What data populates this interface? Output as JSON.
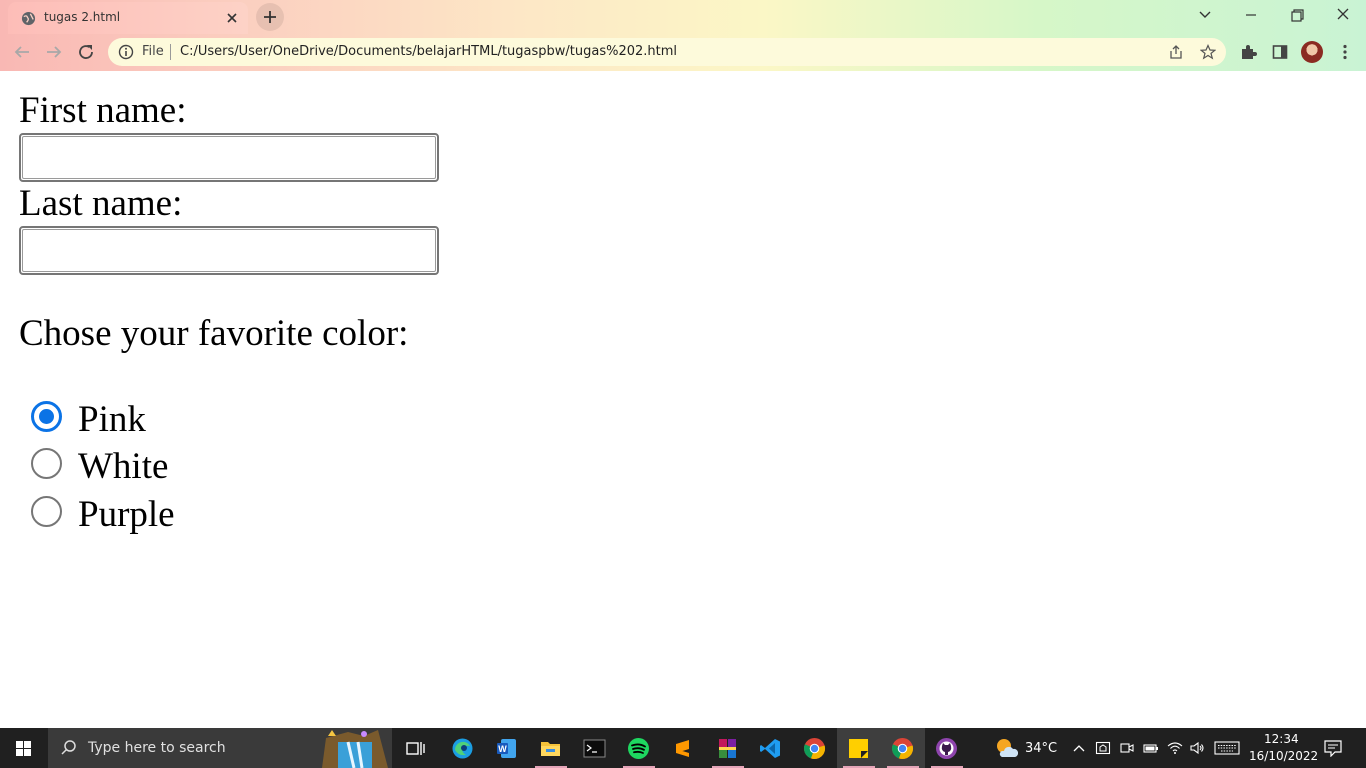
{
  "browser": {
    "tab_title": "tugas 2.html",
    "omnibox_scheme": "File",
    "url": "C:/Users/User/OneDrive/Documents/belajarHTML/tugaspbw/tugas%202.html"
  },
  "form": {
    "first_name_label": "First name:",
    "first_name_value": "",
    "last_name_label": "Last name:",
    "last_name_value": "",
    "color_prompt": "Chose your favorite color:",
    "options": [
      {
        "label": "Pink",
        "checked": true
      },
      {
        "label": "White",
        "checked": false
      },
      {
        "label": "Purple",
        "checked": false
      }
    ]
  },
  "taskbar": {
    "search_placeholder": "Type here to search",
    "weather": "34°C",
    "time": "12:34",
    "date": "16/10/2022",
    "apps": [
      "task-view",
      "edge",
      "word",
      "file-explorer",
      "terminal",
      "spotify",
      "sublime-text",
      "winrar",
      "vscode",
      "chrome",
      "sticky-notes",
      "chrome-active",
      "github-desktop"
    ]
  },
  "colors": {
    "accent": "#0b73e6",
    "taskbar_bg": "#202020"
  }
}
